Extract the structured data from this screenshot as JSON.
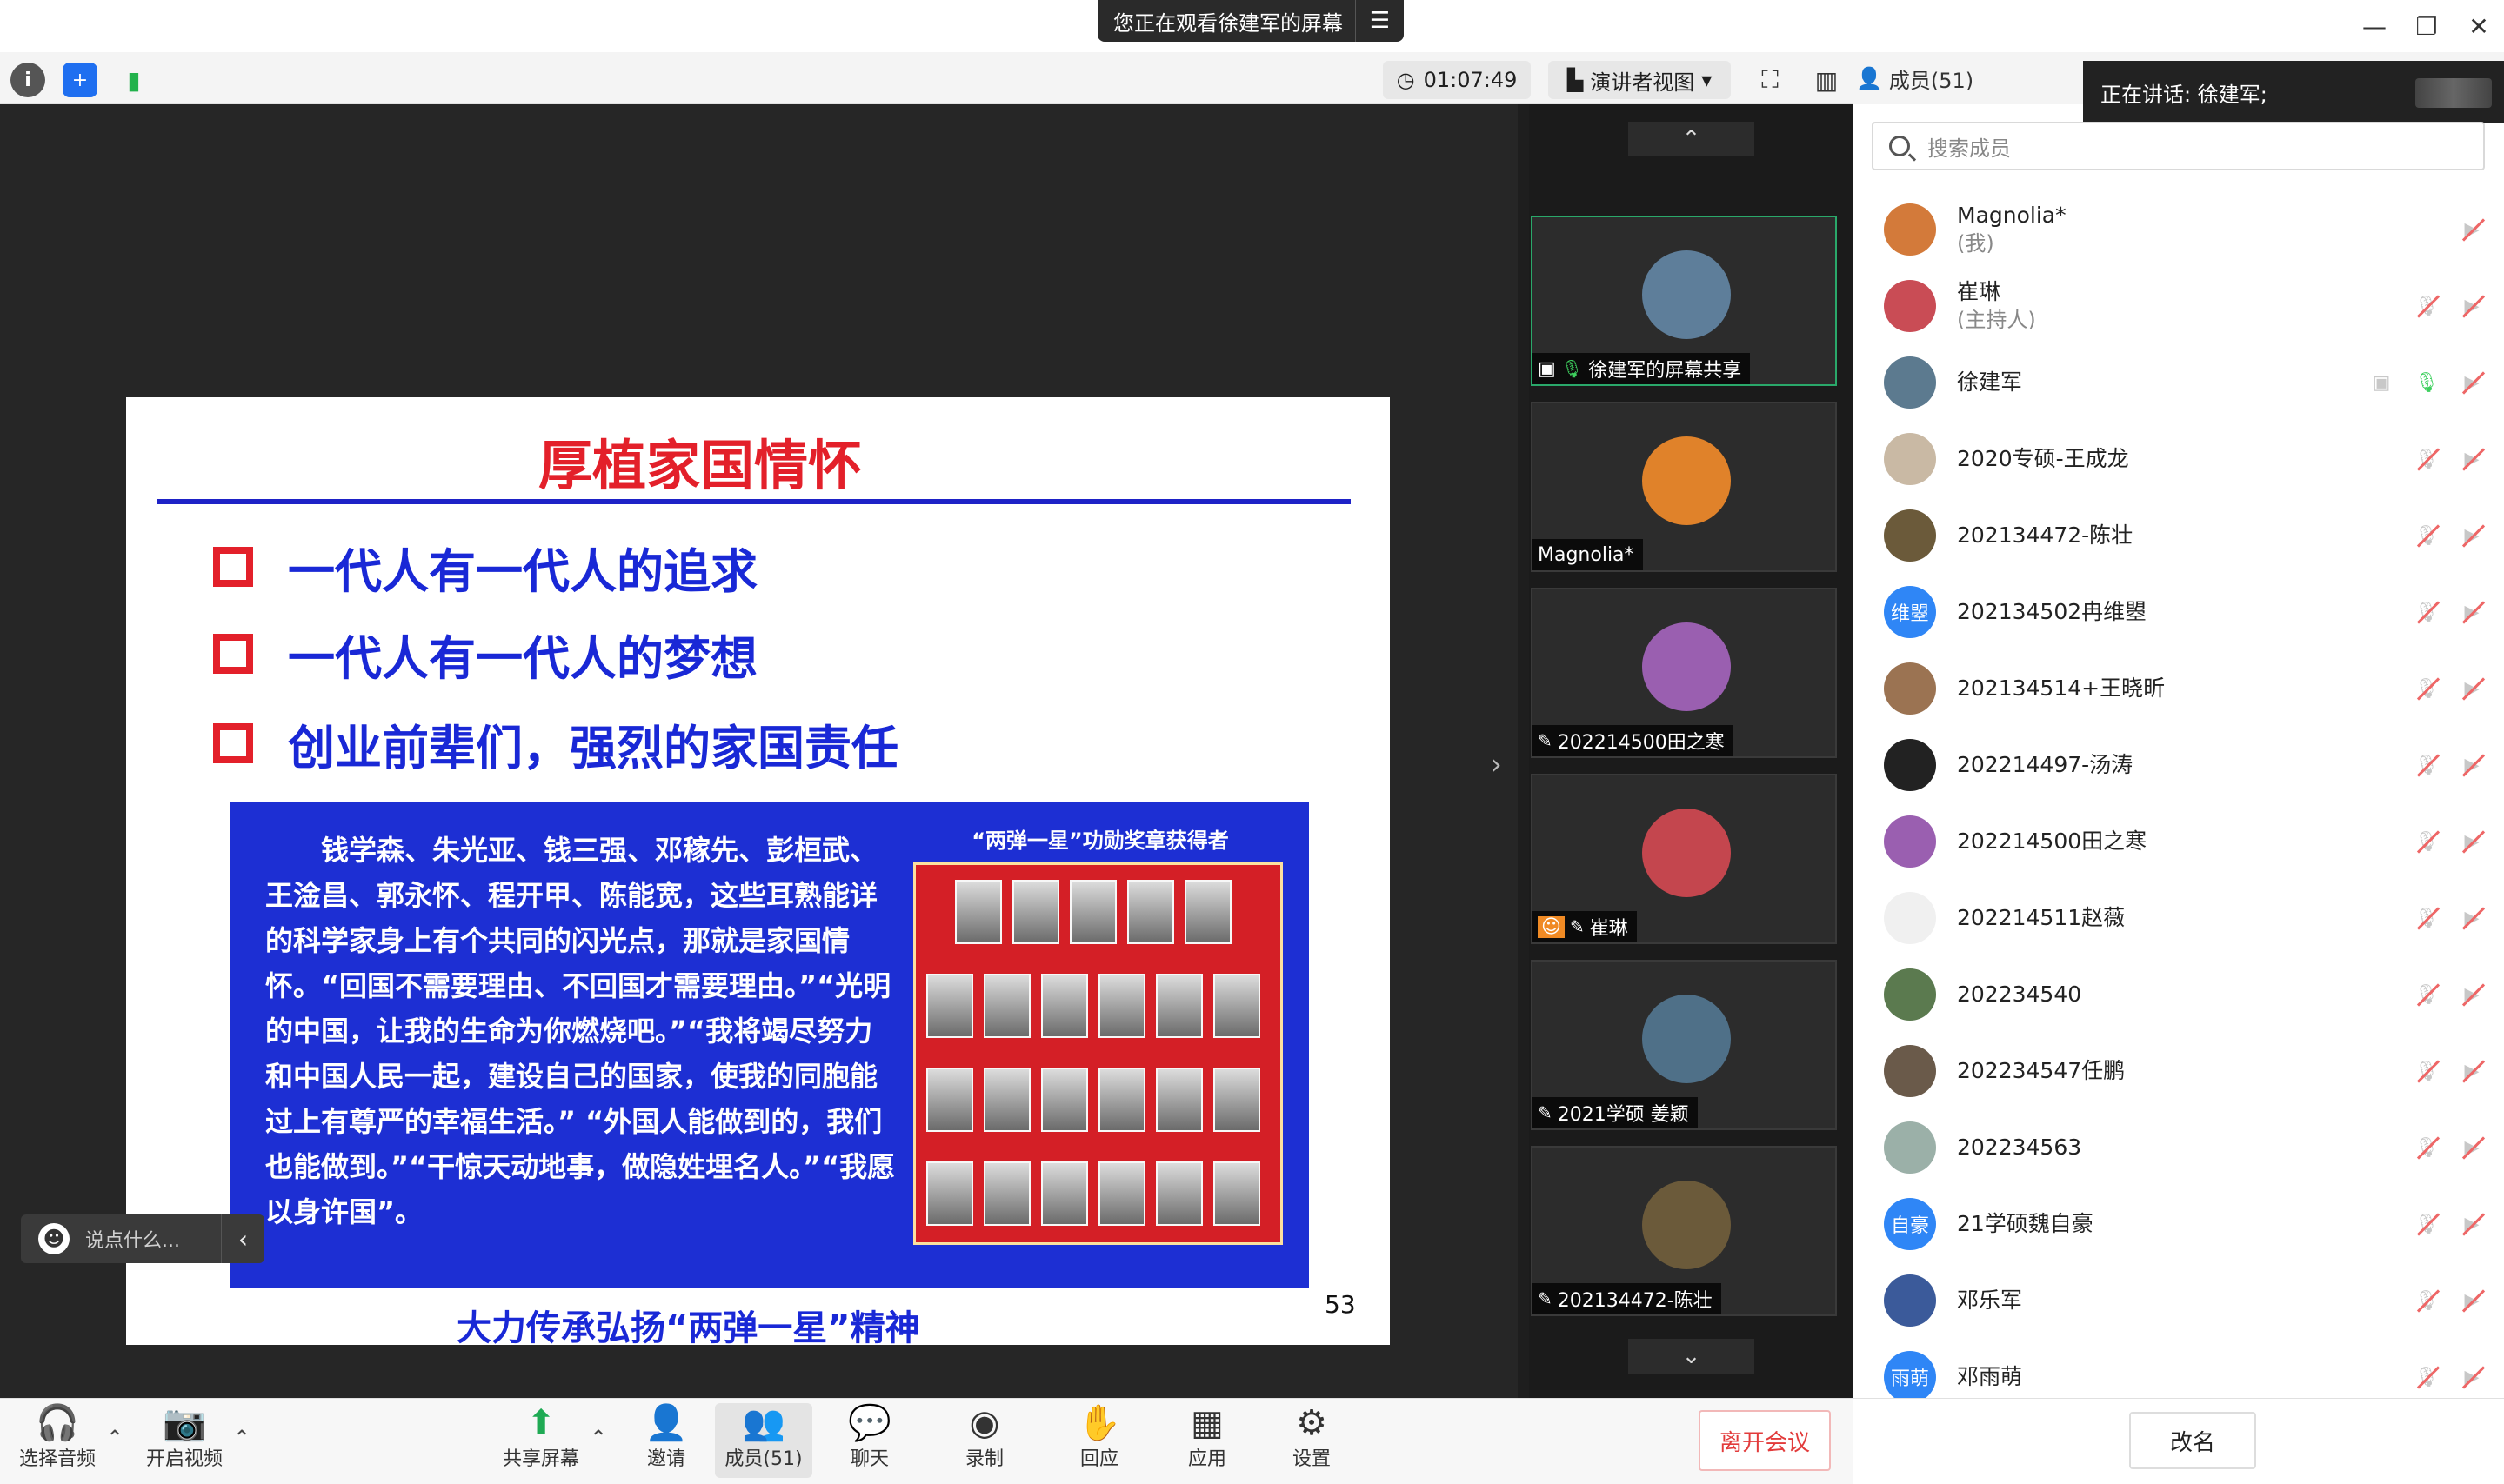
{
  "banner": {
    "text": "您正在观看徐建军的屏幕",
    "menu_icon": "☰"
  },
  "window": {
    "minimize": "—",
    "restore": "❐",
    "close": "✕"
  },
  "toolbar": {
    "info_icon": "i",
    "shield_icon": "+",
    "signal_icon": "▮",
    "timer": "01:07:49",
    "clock_icon": "◷",
    "view_mode": "演讲者视图",
    "view_icon": "▙",
    "dropdown": "▾",
    "fullscreen_icon": "⛶",
    "panel_icon": "▥"
  },
  "slide": {
    "title": "厚植家国情怀",
    "bullets": [
      "一代人有一代人的追求",
      "一代人有一代人的梦想",
      "创业前辈们，强烈的家国责任"
    ],
    "photo_text": "钱学森、朱光亚、钱三强、邓稼先、彭桓武、王淦昌、郭永怀、程开甲、陈能宽，这些耳熟能详的科学家身上有个共同的闪光点，那就是家国情怀。“回国不需要理由、不回国才需要理由。”“光明的中国，让我的生命为你燃烧吧。”“我将竭尽努力和中国人民一起，建设自己的国家，使我的同胞能过上有尊严的幸福生活。” “外国人能做到的，我们也能做到。”“干惊天动地事，做隐姓埋名人。”“我愿以身许国”。",
    "medal_caption": "“两弹一星”功勋奖章获得者",
    "caption": "大力传承弘扬“两弹一星”精神",
    "page_number": "53"
  },
  "chat": {
    "placeholder": "说点什么...",
    "smile_icon": "☻",
    "collapse_icon": "‹"
  },
  "splitter": {
    "expand_icon": "›"
  },
  "gallery": {
    "up_icon": "⌃",
    "down_icon": "⌄",
    "tiles": [
      {
        "name": "徐建军的屏幕共享",
        "share_icon": "▣",
        "mic_icon": "🎙",
        "color": "#5e7e9a"
      },
      {
        "name": "Magnolia*",
        "color": "#e0822a"
      },
      {
        "name": "202214500田之寒",
        "mute_icon": "✎",
        "color": "#9a5fb0"
      },
      {
        "name": "崔琳",
        "mute_icon": "✎",
        "host_icon": "☺",
        "color": "#c4464e"
      },
      {
        "name": "2021学硕 姜颖",
        "mute_icon": "✎",
        "color": "#4f7088"
      },
      {
        "name": "202134472-陈壮",
        "mute_icon": "✎",
        "color": "#6b5a3a"
      }
    ]
  },
  "members": {
    "header": "成员(51)",
    "user_icon": "👤",
    "speaking": "正在讲话: 徐建军;",
    "search_placeholder": "搜索成员",
    "list": [
      {
        "name": "Magnolia*",
        "sub": "(我)",
        "avatar": "",
        "color": "#d37a3a",
        "icons": [
          "video-off"
        ]
      },
      {
        "name": "崔琳",
        "sub": "(主持人)",
        "avatar": "",
        "color": "#c94c55",
        "icons": [
          "mic-off",
          "video-off"
        ]
      },
      {
        "name": "徐建军",
        "sub": "",
        "avatar": "",
        "color": "#5c7a8f",
        "icons": [
          "screen",
          "mic-on",
          "video-off"
        ]
      },
      {
        "name": "2020专硕-王成龙",
        "sub": "",
        "avatar": "",
        "color": "#c9b9a4",
        "icons": [
          "mic-off",
          "video-off"
        ]
      },
      {
        "name": "202134472-陈壮",
        "sub": "",
        "avatar": "",
        "color": "#6b5a3a",
        "icons": [
          "mic-off",
          "video-off"
        ]
      },
      {
        "name": "202134502冉维曌",
        "sub": "",
        "avatar": "维曌",
        "color": "#2f86f6",
        "icons": [
          "mic-off",
          "video-off"
        ]
      },
      {
        "name": "202134514+王晓昕",
        "sub": "",
        "avatar": "",
        "color": "#9b7352",
        "icons": [
          "mic-off",
          "video-off"
        ]
      },
      {
        "name": "202214497-汤涛",
        "sub": "",
        "avatar": "",
        "color": "#222222",
        "icons": [
          "mic-off",
          "video-off"
        ]
      },
      {
        "name": "202214500田之寒",
        "sub": "",
        "avatar": "",
        "color": "#9a5fb0",
        "icons": [
          "mic-off",
          "video-off"
        ]
      },
      {
        "name": "202214511赵薇",
        "sub": "",
        "avatar": "",
        "color": "#f0f0f0",
        "icons": [
          "mic-off",
          "video-off"
        ]
      },
      {
        "name": "202234540",
        "sub": "",
        "avatar": "",
        "color": "#5b7a4f",
        "icons": [
          "mic-off",
          "video-off"
        ]
      },
      {
        "name": "202234547任鹏",
        "sub": "",
        "avatar": "",
        "color": "#6a5a4a",
        "icons": [
          "mic-off",
          "video-off"
        ]
      },
      {
        "name": "202234563",
        "sub": "",
        "avatar": "",
        "color": "#9bb0a8",
        "icons": [
          "mic-off",
          "video-off"
        ]
      },
      {
        "name": "21学硕魏自豪",
        "sub": "",
        "avatar": "自豪",
        "color": "#2f86f6",
        "icons": [
          "mic-off",
          "video-off"
        ]
      },
      {
        "name": "邓乐军",
        "sub": "",
        "avatar": "",
        "color": "#3b5a9a",
        "icons": [
          "mic-off",
          "video-off"
        ]
      },
      {
        "name": "邓雨萌",
        "sub": "",
        "avatar": "雨萌",
        "color": "#2f86f6",
        "icons": [
          "mic-off",
          "video-off"
        ]
      }
    ],
    "rename": "改名"
  },
  "bottombar": {
    "audio": {
      "label": "选择音频",
      "icon": "🎧"
    },
    "video": {
      "label": "开启视频",
      "icon": "📷"
    },
    "share": {
      "label": "共享屏幕",
      "icon": "⬆"
    },
    "invite": {
      "label": "邀请",
      "icon": "👤"
    },
    "members": {
      "label": "成员(51)",
      "icon": "👥"
    },
    "chat": {
      "label": "聊天",
      "icon": "💬"
    },
    "record": {
      "label": "录制",
      "icon": "◉"
    },
    "react": {
      "label": "回应",
      "icon": "✋"
    },
    "apps": {
      "label": "应用",
      "icon": "▦"
    },
    "settings": {
      "label": "设置",
      "icon": "⚙"
    },
    "caret": "⌃",
    "leave": "离开会议"
  }
}
